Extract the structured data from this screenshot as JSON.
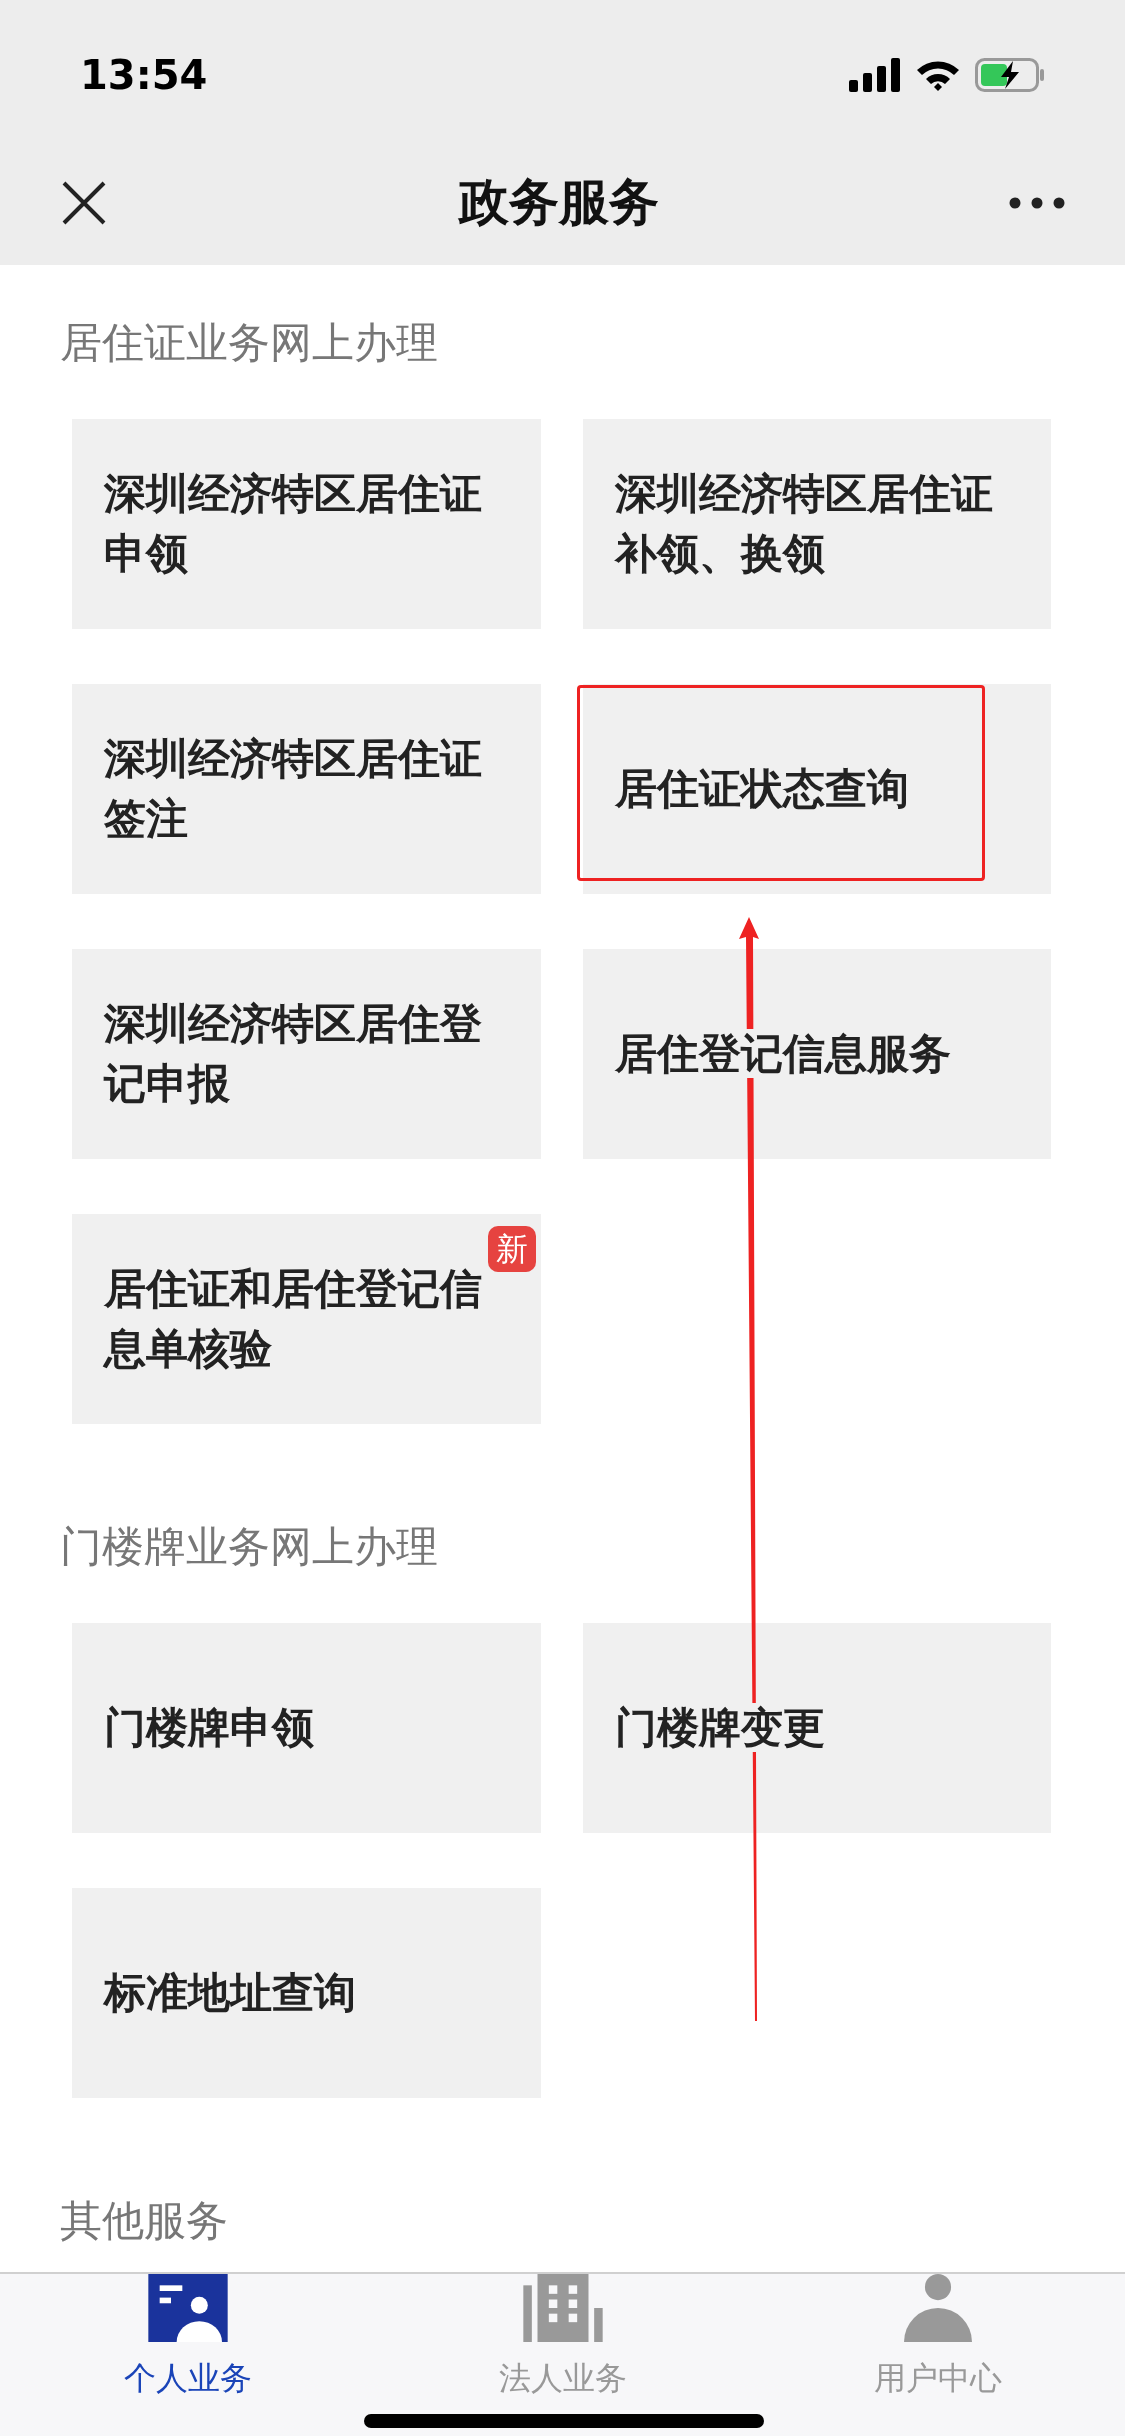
{
  "status_bar": {
    "time": "13:54"
  },
  "nav_bar": {
    "title": "政务服务"
  },
  "sections": [
    {
      "title": "居住证业务网上办理",
      "items": [
        {
          "label": "深圳经济特区居住证申领",
          "highlighted": false
        },
        {
          "label": "深圳经济特区居住证补领、换领",
          "highlighted": false
        },
        {
          "label": "深圳经济特区居住证签注",
          "highlighted": false
        },
        {
          "label": "居住证状态查询",
          "highlighted": true
        },
        {
          "label": "深圳经济特区居住登记申报",
          "highlighted": false
        },
        {
          "label": "居住登记信息服务",
          "highlighted": false
        },
        {
          "label": "居住证和居住登记信息单核验",
          "badge": "新",
          "highlighted": false
        }
      ]
    },
    {
      "title": "门楼牌业务网上办理",
      "items": [
        {
          "label": "门楼牌申领",
          "highlighted": false
        },
        {
          "label": "门楼牌变更",
          "highlighted": false
        },
        {
          "label": "标准地址查询",
          "highlighted": false
        }
      ]
    },
    {
      "title": "其他服务"
    }
  ],
  "tab_bar": [
    {
      "label": "个人业务",
      "kind": "person-card",
      "selected": true
    },
    {
      "label": "法人业务",
      "kind": "building",
      "selected": false
    },
    {
      "label": "用户中心",
      "kind": "user",
      "selected": false
    }
  ]
}
